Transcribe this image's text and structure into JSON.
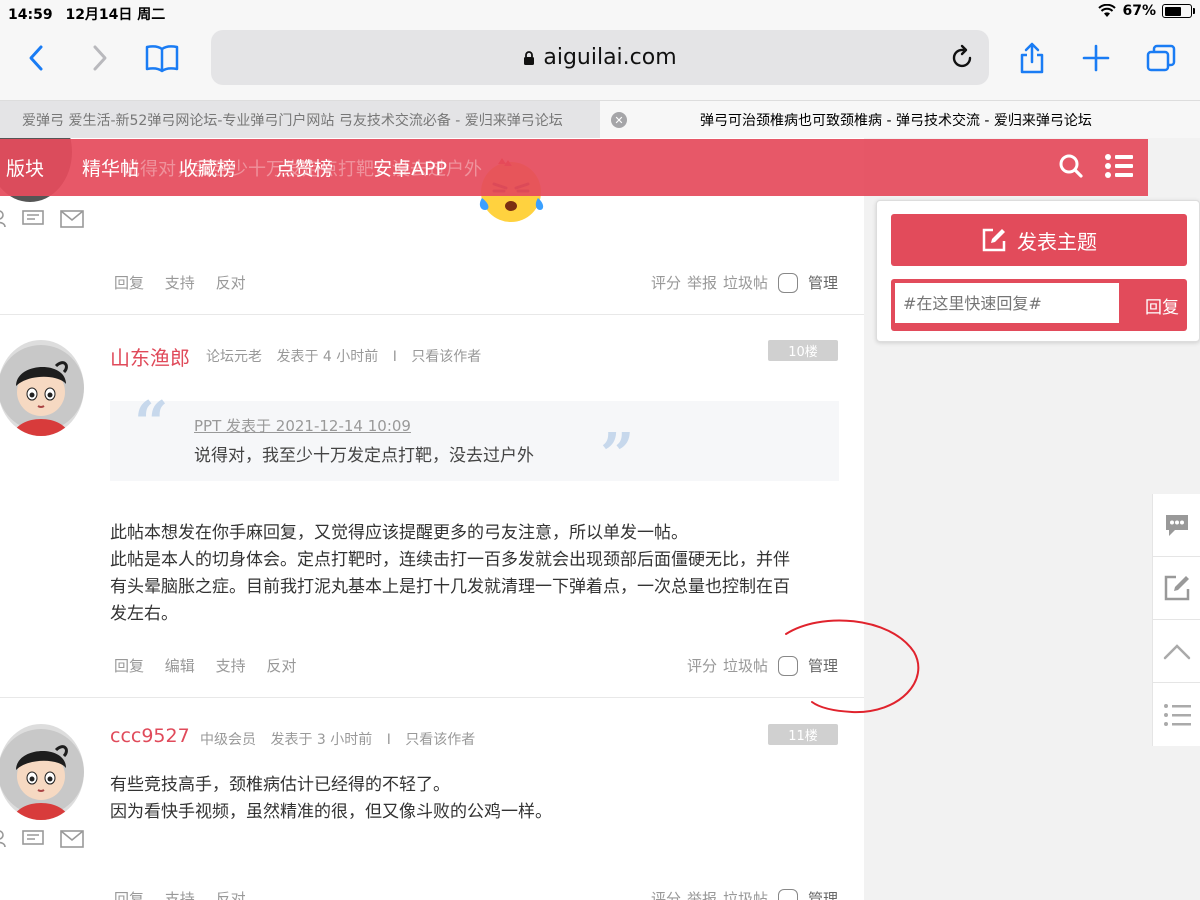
{
  "status": {
    "time": "14:59",
    "date": "12月14日 周二",
    "battery": "67%",
    "battery_level": 0.67
  },
  "browser": {
    "url": "aiguilai.com",
    "tabs": [
      {
        "title": "爱弹弓 爱生活-新52弹弓网论坛-专业弹弓门户网站 弓友技术交流必备 - 爱归来弹弓论坛"
      },
      {
        "title": "弹弓可治颈椎病也可致颈椎病 - 弹弓技术交流 - 爱归来弹弓论坛"
      }
    ]
  },
  "nav": {
    "items": [
      "版块",
      "精华帖",
      "收藏榜",
      "点赞榜",
      "安卓APP"
    ],
    "ghost_text": "说得对，我至少十万发定点打靶，没去过户外"
  },
  "posts": [
    {
      "actions_left": [
        "回复",
        "支持",
        "反对"
      ],
      "actions_right": [
        "评分",
        "举报",
        "垃圾帖"
      ],
      "manage": "管理"
    },
    {
      "author": "山东渔郎",
      "rank": "论坛元老",
      "posted": "发表于 4 小时前",
      "sep": "I",
      "only_author": "只看该作者",
      "floor": "10楼",
      "quote_head": "PPT 发表于 2021-12-14 10:09",
      "quote_text": "说得对，我至少十万发定点打靶，没去过户外",
      "lines": [
        "此帖本想发在你手麻回复，又觉得应该提醒更多的弓友注意，所以单发一帖。",
        "此帖是本人的切身体会。定点打靶时，连续击打一百多发就会出现颈部后面僵硬无比，并伴",
        "有头晕脑胀之症。目前我打泥丸基本上是打十几发就清理一下弹着点，一次总量也控制在百",
        "发左右。"
      ],
      "actions_left": [
        "回复",
        "编辑",
        "支持",
        "反对"
      ],
      "actions_right": [
        "评分",
        "垃圾帖"
      ],
      "manage": "管理"
    },
    {
      "author": "ccc9527",
      "rank": "中级会员",
      "posted": "发表于 3 小时前",
      "sep": "I",
      "only_author": "只看该作者",
      "floor": "11楼",
      "lines": [
        "有些竞技高手，颈椎病估计已经得的不轻了。",
        "因为看快手视频，虽然精准的很，但又像斗败的公鸡一样。"
      ],
      "actions_left": [
        "回复",
        "支持",
        "反对"
      ],
      "actions_right": [
        "评分",
        "举报",
        "垃圾帖"
      ],
      "manage": "管理"
    }
  ],
  "panel": {
    "post_button": "发表主题",
    "quick_reply_placeholder": "#在这里快速回复#",
    "reply_button": "回复"
  },
  "colors": {
    "accent": "#e24b5b",
    "author": "#e04a5a"
  }
}
